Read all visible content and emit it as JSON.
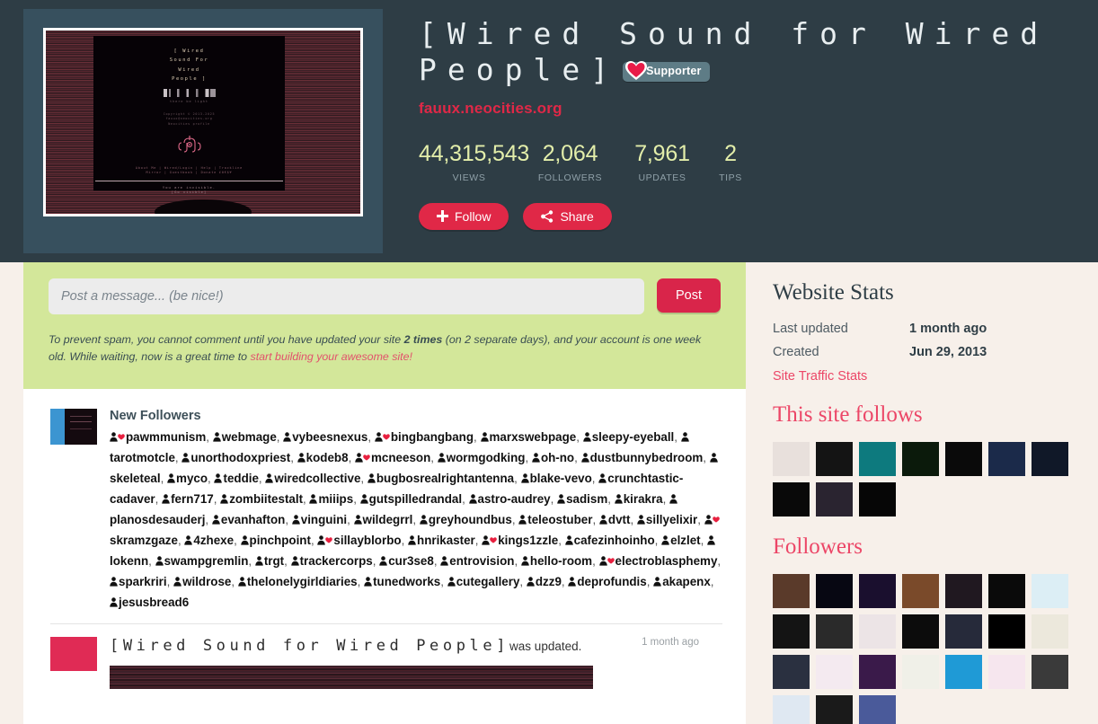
{
  "header": {
    "site_title": "[Wired Sound for Wired People]",
    "supporter_badge": "Supporter",
    "site_url": "fauux.neocities.org",
    "stats": [
      {
        "num": "44,315,543",
        "label": "VIEWS"
      },
      {
        "num": "2,064",
        "label": "FOLLOWERS"
      },
      {
        "num": "7,961",
        "label": "UPDATES"
      },
      {
        "num": "2",
        "label": "TIPS"
      }
    ],
    "follow_button": "Follow",
    "share_button": "Share",
    "thumbnail": {
      "title_lines": [
        "[  Wired",
        "Sound For",
        "Wired",
        "People  ]"
      ],
      "subtitle": "there be light",
      "copyright": [
        "Copyright © 2013-2025",
        "fauux@neocities.org",
        "Neocities profile"
      ],
      "nav_line1": "About Me | Wired/Login | Help | Trackline",
      "nav_line2": "Mirror | Guestbook | Donate £0€$¥",
      "footer1": "You are invisible.",
      "footer2": "[Go visible]"
    }
  },
  "comment": {
    "placeholder": "Post a message... (be nice!)",
    "post_label": "Post",
    "notice_part1": "To prevent spam, you cannot comment until you have updated your site ",
    "notice_bold": "2 times",
    "notice_part2": " (on 2 separate days), and your account is one week old. While waiting, now is a great time to ",
    "notice_link": "start building your awesome site!"
  },
  "new_followers": {
    "heading": "New Followers",
    "names": [
      {
        "name": "pawmmunism",
        "supporter": true
      },
      {
        "name": "webmage",
        "supporter": false
      },
      {
        "name": "vybeesnexus",
        "supporter": false
      },
      {
        "name": "bingbangbang",
        "supporter": true
      },
      {
        "name": "marxswebpage",
        "supporter": false
      },
      {
        "name": "sleepy-eyeball",
        "supporter": false
      },
      {
        "name": "tarotmotcle",
        "supporter": false
      },
      {
        "name": "unorthodoxpriest",
        "supporter": false
      },
      {
        "name": "kodeb8",
        "supporter": false
      },
      {
        "name": "mcneeson",
        "supporter": true
      },
      {
        "name": "wormgodking",
        "supporter": false
      },
      {
        "name": "oh-no",
        "supporter": false
      },
      {
        "name": "dustbunnybedroom",
        "supporter": false
      },
      {
        "name": "skeleteal",
        "supporter": false
      },
      {
        "name": "myco",
        "supporter": false
      },
      {
        "name": "teddie",
        "supporter": false
      },
      {
        "name": "wiredcollective",
        "supporter": false
      },
      {
        "name": "bugbosrealrightantenna",
        "supporter": false
      },
      {
        "name": "blake-vevo",
        "supporter": false
      },
      {
        "name": "crunchtastic-cadaver",
        "supporter": false
      },
      {
        "name": "fern717",
        "supporter": false
      },
      {
        "name": "zombiitestalt",
        "supporter": false
      },
      {
        "name": "miiips",
        "supporter": false
      },
      {
        "name": "gutspilledrandal",
        "supporter": false
      },
      {
        "name": "astro-audrey",
        "supporter": false
      },
      {
        "name": "sadism",
        "supporter": false
      },
      {
        "name": "kirakra",
        "supporter": false
      },
      {
        "name": "planosdesauderj",
        "supporter": false
      },
      {
        "name": "evanhafton",
        "supporter": false
      },
      {
        "name": "vinguini",
        "supporter": false
      },
      {
        "name": "wildegrrl",
        "supporter": false
      },
      {
        "name": "greyhoundbus",
        "supporter": false
      },
      {
        "name": "teleostuber",
        "supporter": false
      },
      {
        "name": "dvtt",
        "supporter": false
      },
      {
        "name": "sillyelixir",
        "supporter": false
      },
      {
        "name": "skramzgaze",
        "supporter": true
      },
      {
        "name": "4zhexe",
        "supporter": false
      },
      {
        "name": "pinchpoint",
        "supporter": false
      },
      {
        "name": "sillayblorbo",
        "supporter": true
      },
      {
        "name": "hnrikaster",
        "supporter": false
      },
      {
        "name": "kings1zzle",
        "supporter": true
      },
      {
        "name": "cafezinhoinho",
        "supporter": false
      },
      {
        "name": "elzlet",
        "supporter": false
      },
      {
        "name": "lokenn",
        "supporter": false
      },
      {
        "name": "swampgremlin",
        "supporter": false
      },
      {
        "name": "trgt",
        "supporter": false
      },
      {
        "name": "trackercorps",
        "supporter": false
      },
      {
        "name": "cur3se8",
        "supporter": false
      },
      {
        "name": "entrovision",
        "supporter": false
      },
      {
        "name": "hello-room",
        "supporter": false
      },
      {
        "name": "electroblasphemy",
        "supporter": true
      },
      {
        "name": "sparkriri",
        "supporter": false
      },
      {
        "name": "wildrose",
        "supporter": false
      },
      {
        "name": "thelonelygirldiaries",
        "supporter": false
      },
      {
        "name": "tunedworks",
        "supporter": false
      },
      {
        "name": "cutegallery",
        "supporter": false
      },
      {
        "name": "dzz9",
        "supporter": false
      },
      {
        "name": "deprofundis",
        "supporter": false
      },
      {
        "name": "akapenx",
        "supporter": false
      },
      {
        "name": "jesusbread6",
        "supporter": false
      }
    ]
  },
  "update_entry": {
    "title": "[Wired Sound for Wired People]",
    "suffix": "was updated.",
    "time": "1 month ago"
  },
  "sidebar": {
    "website_stats_heading": "Website Stats",
    "last_updated_label": "Last updated",
    "last_updated_value": "1 month ago",
    "created_label": "Created",
    "created_value": "Jun 29, 2013",
    "traffic_link": "Site Traffic Stats",
    "follows_heading": "This site follows",
    "followers_heading": "Followers",
    "follows_thumbs": [
      "#e8e0dc",
      "#141414",
      "#0d7a7e",
      "#0b1a0b",
      "#0a0a0a",
      "#1b2a4a",
      "#101828",
      "#090909",
      "#2a2430",
      "#060606"
    ],
    "followers_thumbs": [
      "#5a3a2a",
      "#070712",
      "#1a0f2e",
      "#7a4a2a",
      "#201820",
      "#0a0a0a",
      "#dceef5",
      "#141414",
      "#2a2a2a",
      "#ece4e6",
      "#0c0c0c",
      "#262a3a",
      "#000000",
      "#ece8dc",
      "#2a3040",
      "#f4eaf0",
      "#3a1a4a",
      "#f0f0e8",
      "#1f9ad6",
      "#f6e6ee",
      "#3a3a3a",
      "#dfe8f2",
      "#1a1a1a",
      "#4a5a9a"
    ]
  },
  "colors": {
    "accent_red": "#e02847",
    "header_bg": "#2e3d45",
    "page_bg": "#f7f0ea",
    "comment_green": "#d3e79a",
    "stat_number": "#e3eeaa"
  }
}
